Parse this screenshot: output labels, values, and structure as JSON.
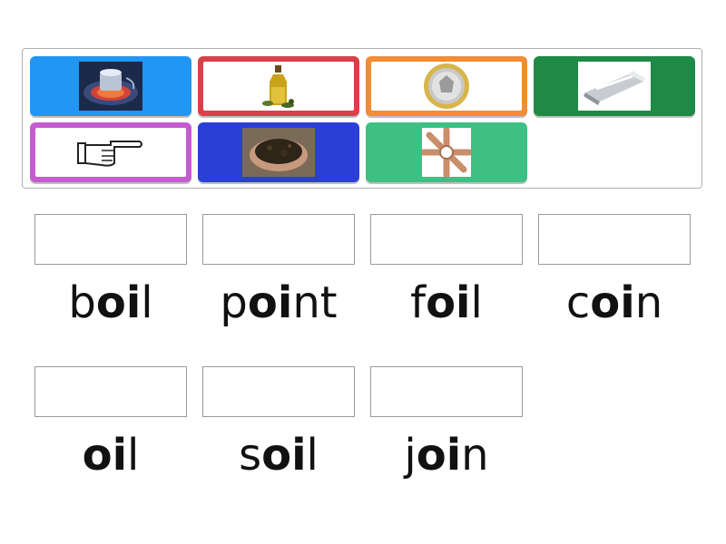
{
  "tiles": [
    {
      "id": "hob",
      "color": "#2196f3",
      "icon": "hob-icon"
    },
    {
      "id": "olive-oil",
      "color": "#d9404a",
      "icon": "olive-oil-icon"
    },
    {
      "id": "coin",
      "color": "#f28c35",
      "icon": "coin-icon"
    },
    {
      "id": "foil",
      "color": "#1e8a45",
      "icon": "foil-icon"
    },
    {
      "id": "point",
      "color": "#c65bd0",
      "icon": "pointing-hand-icon"
    },
    {
      "id": "soil",
      "color": "#2b3fd6",
      "icon": "soil-icon"
    },
    {
      "id": "join",
      "color": "#3ebf83",
      "icon": "joined-hands-icon"
    }
  ],
  "words": [
    {
      "pre": "b",
      "vowel": "oi",
      "post": "l"
    },
    {
      "pre": "p",
      "vowel": "oi",
      "post": "nt"
    },
    {
      "pre": "f",
      "vowel": "oi",
      "post": "l"
    },
    {
      "pre": "c",
      "vowel": "oi",
      "post": "n"
    },
    {
      "pre": "",
      "vowel": "oi",
      "post": "l"
    },
    {
      "pre": "s",
      "vowel": "oi",
      "post": "l"
    },
    {
      "pre": "j",
      "vowel": "oi",
      "post": "n"
    }
  ]
}
